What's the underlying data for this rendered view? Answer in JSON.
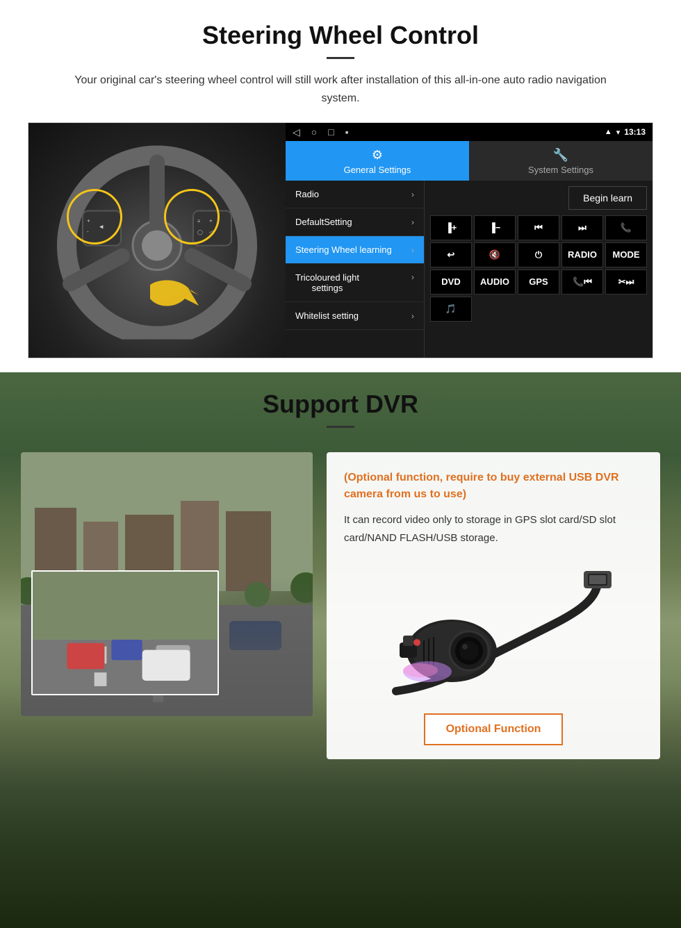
{
  "steering": {
    "title": "Steering Wheel Control",
    "description": "Your original car's steering wheel control will still work after installation of this all-in-one auto radio navigation system.",
    "statusbar": {
      "time": "13:13",
      "signal_icon": "▾",
      "wifi_icon": "▾",
      "battery_icon": "▮"
    },
    "tabs": {
      "general": {
        "icon": "⚙",
        "label": "General Settings"
      },
      "system": {
        "icon": "🔧",
        "label": "System Settings"
      }
    },
    "menu": {
      "items": [
        {
          "label": "Radio",
          "chevron": "›",
          "active": false
        },
        {
          "label": "DefaultSetting",
          "chevron": "›",
          "active": false
        },
        {
          "label": "Steering Wheel learning",
          "chevron": "›",
          "active": true
        },
        {
          "label": "Tricoloured light settings",
          "chevron": "›",
          "active": false
        },
        {
          "label": "Whitelist setting",
          "chevron": "›",
          "active": false
        }
      ]
    },
    "begin_learn": "Begin learn",
    "controls": [
      {
        "icon": "⏮+",
        "label": ""
      },
      {
        "icon": "⏮-",
        "label": ""
      },
      {
        "icon": "⏮⏮",
        "label": ""
      },
      {
        "icon": "⏭⏭",
        "label": ""
      },
      {
        "icon": "📞",
        "label": ""
      },
      {
        "icon": "↩",
        "label": ""
      },
      {
        "icon": "🔇",
        "label": ""
      },
      {
        "icon": "⏻",
        "label": ""
      },
      {
        "icon": "RADIO",
        "label": ""
      },
      {
        "icon": "MODE",
        "label": ""
      },
      {
        "icon": "DVD",
        "label": ""
      },
      {
        "icon": "AUDIO",
        "label": ""
      },
      {
        "icon": "GPS",
        "label": ""
      },
      {
        "icon": "📞⏮",
        "label": ""
      },
      {
        "icon": "✂⏭",
        "label": ""
      },
      {
        "icon": "🎵",
        "label": ""
      }
    ]
  },
  "dvr": {
    "title": "Support DVR",
    "optional_notice": "(Optional function, require to buy external USB DVR camera from us to use)",
    "body_text": "It can record video only to storage in GPS slot card/SD slot card/NAND FLASH/USB storage.",
    "optional_btn": "Optional Function"
  }
}
